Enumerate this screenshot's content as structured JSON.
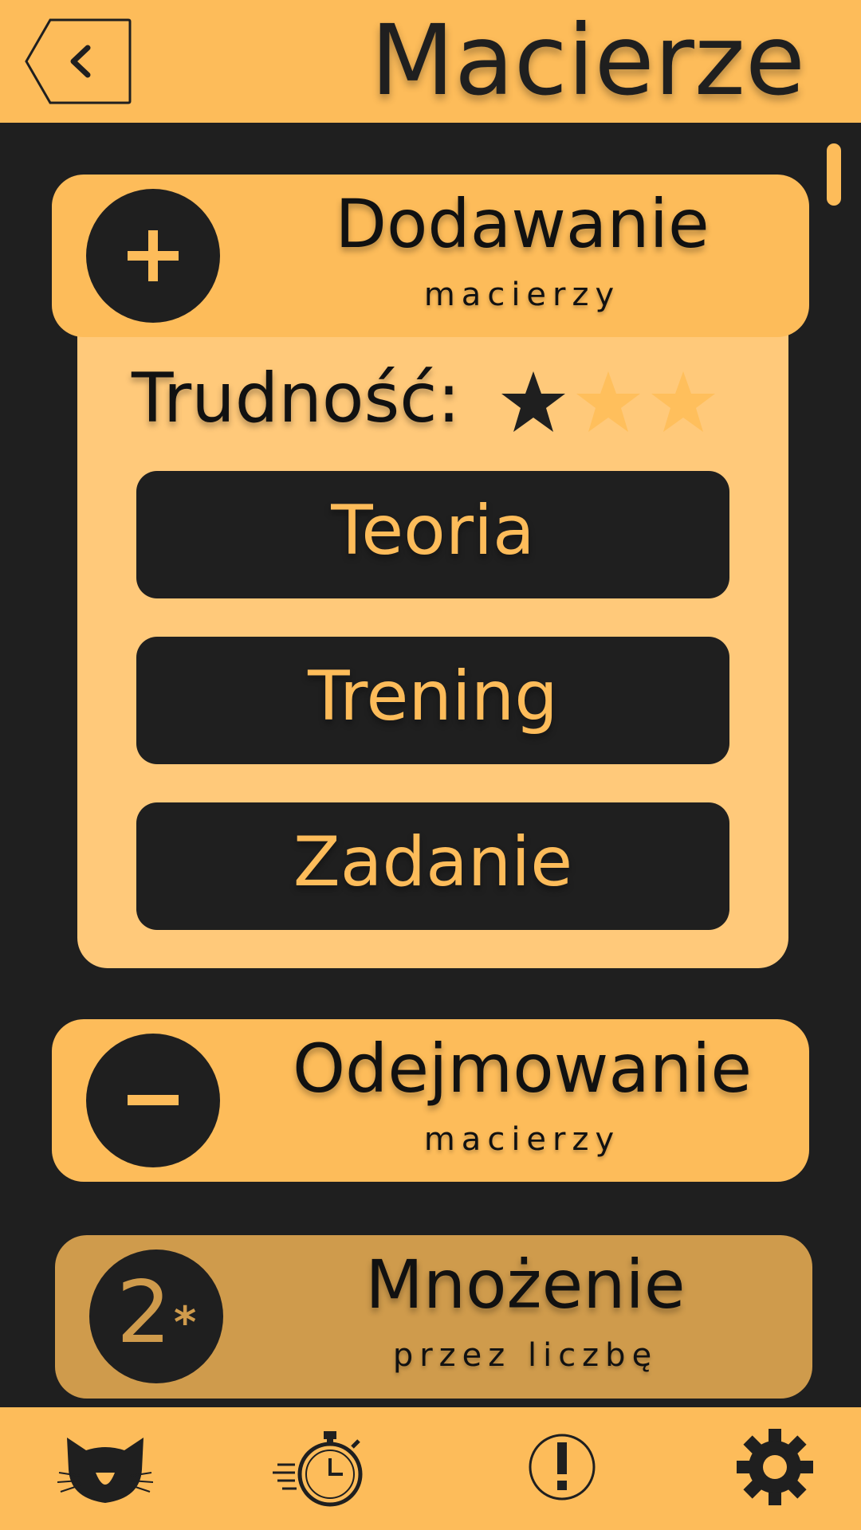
{
  "header": {
    "title": "Macierze",
    "back_icon": "chevron-left-icon"
  },
  "colors": {
    "accent": "#fdbc5a",
    "accent_light": "#ffc97a",
    "accent_dim": "#cf9b4c",
    "background": "#1f1f1f"
  },
  "sections": [
    {
      "title": "Dodawanie",
      "subtitle": "macierzy",
      "icon": "plus-icon",
      "expanded": true,
      "difficulty_label": "Trudność:",
      "difficulty_level": 1,
      "difficulty_max": 3,
      "buttons": [
        "Teoria",
        "Trening",
        "Zadanie"
      ]
    },
    {
      "title": "Odejmowanie",
      "subtitle": "macierzy",
      "icon": "minus-icon",
      "expanded": false
    },
    {
      "title": "Mnożenie",
      "subtitle": "przez liczbę",
      "icon": "scalar-multiply-icon",
      "icon_text": "2",
      "icon_sup": "*",
      "expanded": false
    }
  ],
  "bottom_nav": [
    {
      "icon": "cat-icon"
    },
    {
      "icon": "stopwatch-icon"
    },
    {
      "icon": "exclamation-icon"
    },
    {
      "icon": "gear-icon"
    }
  ]
}
